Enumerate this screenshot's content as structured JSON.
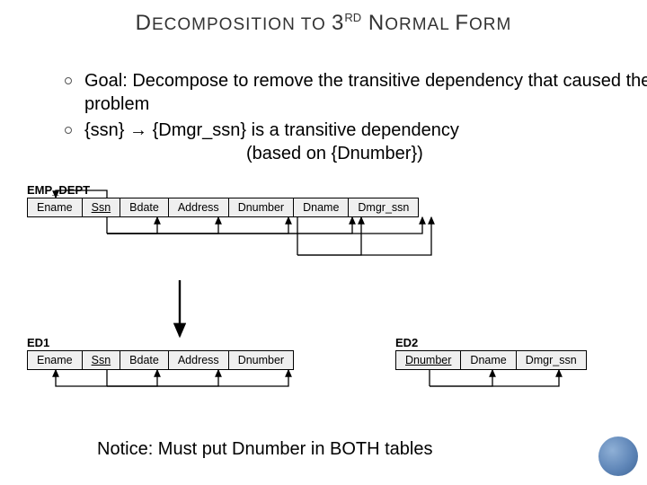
{
  "title": {
    "pre": "D",
    "word1_rest": "ECOMPOSITION TO ",
    "three": "3",
    "rd": "RD",
    "space": " ",
    "n": "N",
    "normal_rest": "ORMAL ",
    "f": "F",
    "form_rest": "ORM"
  },
  "bullets": {
    "b1": "Goal:  Decompose to remove the transitive dependency that caused the problem",
    "b2a": "{ssn} → {Dmgr_ssn} is a transitive dependency",
    "b2b": "(based on {Dnumber})"
  },
  "diagram": {
    "emp_dept_label": "EMP_DEPT",
    "emp_dept_cols": [
      "Ename",
      "Ssn",
      "Bdate",
      "Address",
      "Dnumber",
      "Dname",
      "Dmgr_ssn"
    ],
    "ed1_label": "ED1",
    "ed1_cols": [
      "Ename",
      "Ssn",
      "Bdate",
      "Address",
      "Dnumber"
    ],
    "ed2_label": "ED2",
    "ed2_cols": [
      "Dnumber",
      "Dname",
      "Dmgr_ssn"
    ]
  },
  "notice": "Notice:  Must put Dnumber in BOTH tables"
}
